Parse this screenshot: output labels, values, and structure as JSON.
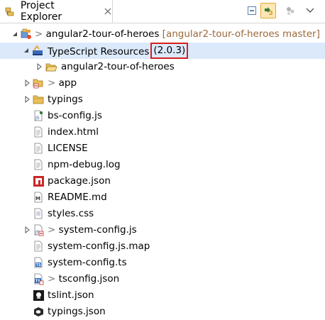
{
  "view": {
    "title": "Project Explorer",
    "close_glyph": "✕"
  },
  "toolbar": {
    "buttons": [
      {
        "name": "collapse-all-icon"
      },
      {
        "name": "link-with-editor-icon",
        "pressed": true
      },
      {
        "name": "focus-icon"
      },
      {
        "name": "view-menu-icon"
      }
    ]
  },
  "tree": {
    "project": {
      "prefix": ">",
      "name": "angular2-tour-of-heroes",
      "git": "[angular2-tour-of-heroes master]"
    },
    "ts_resources": {
      "label": "TypeScript Resources",
      "version": "(2.0.3)"
    },
    "ts_child": {
      "label": "angular2-tour-of-heroes"
    },
    "items": [
      {
        "prefix": ">",
        "label": "app",
        "icon": "folder-icon"
      },
      {
        "prefix": "",
        "label": "typings",
        "icon": "folder-icon"
      },
      {
        "prefix": "",
        "label": "bs-config.js",
        "icon": "js-file-icon"
      },
      {
        "prefix": "",
        "label": "index.html",
        "icon": "file-icon"
      },
      {
        "prefix": "",
        "label": "LICENSE",
        "icon": "file-icon"
      },
      {
        "prefix": "",
        "label": "npm-debug.log",
        "icon": "file-icon"
      },
      {
        "prefix": "",
        "label": "package.json",
        "icon": "npm-file-icon"
      },
      {
        "prefix": "",
        "label": "README.md",
        "icon": "markdown-file-icon"
      },
      {
        "prefix": "",
        "label": "styles.css",
        "icon": "css-file-icon"
      },
      {
        "prefix": ">",
        "label": "system-config.js",
        "icon": "js-file-icon"
      },
      {
        "prefix": "",
        "label": "system-config.js.map",
        "icon": "file-icon"
      },
      {
        "prefix": "",
        "label": "system-config.ts",
        "icon": "ts-file-icon"
      },
      {
        "prefix": ">",
        "label": "tsconfig.json",
        "icon": "tsconfig-file-icon"
      },
      {
        "prefix": "",
        "label": "tslint.json",
        "icon": "tslint-file-icon"
      },
      {
        "prefix": "",
        "label": "typings.json",
        "icon": "typings-file-icon"
      }
    ]
  }
}
